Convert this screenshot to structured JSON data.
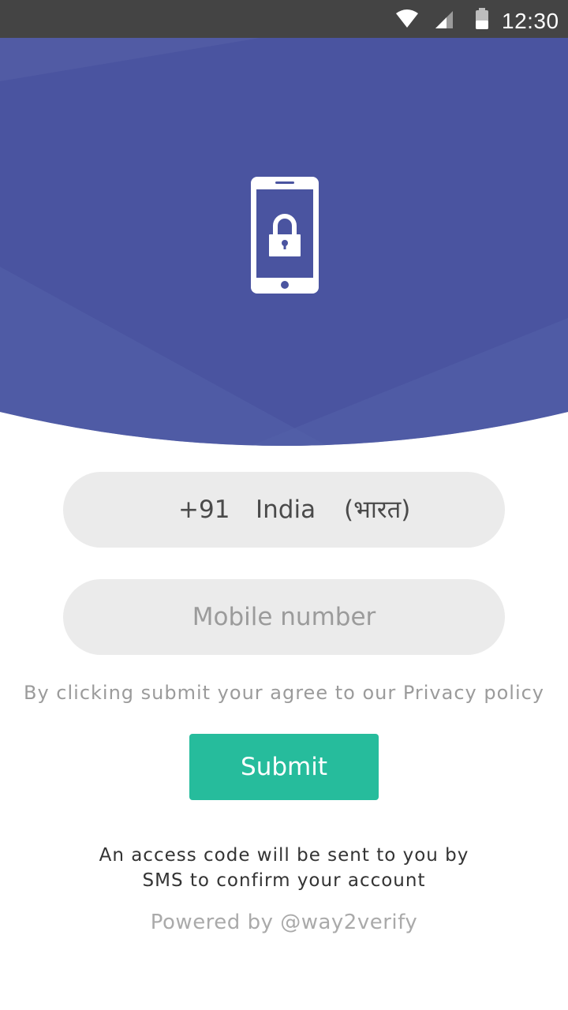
{
  "status_bar": {
    "time": "12:30",
    "icons": [
      "wifi-icon",
      "cellular-signal-icon",
      "battery-icon"
    ]
  },
  "header": {
    "icon": "phone-lock-icon",
    "background_color": "#4a54a0"
  },
  "country": {
    "code": "+91",
    "name": "India",
    "native_name": "(भारत)"
  },
  "mobile": {
    "placeholder": "Mobile number",
    "value": ""
  },
  "privacy_text": "By clicking submit your agree to our Privacy policy",
  "submit_label": "Submit",
  "submit_color": "#26bc9c",
  "info_text": {
    "line1": "An access code will be sent to you by",
    "line2": "SMS to confirm your account"
  },
  "powered_by": "Powered by @way2verify"
}
